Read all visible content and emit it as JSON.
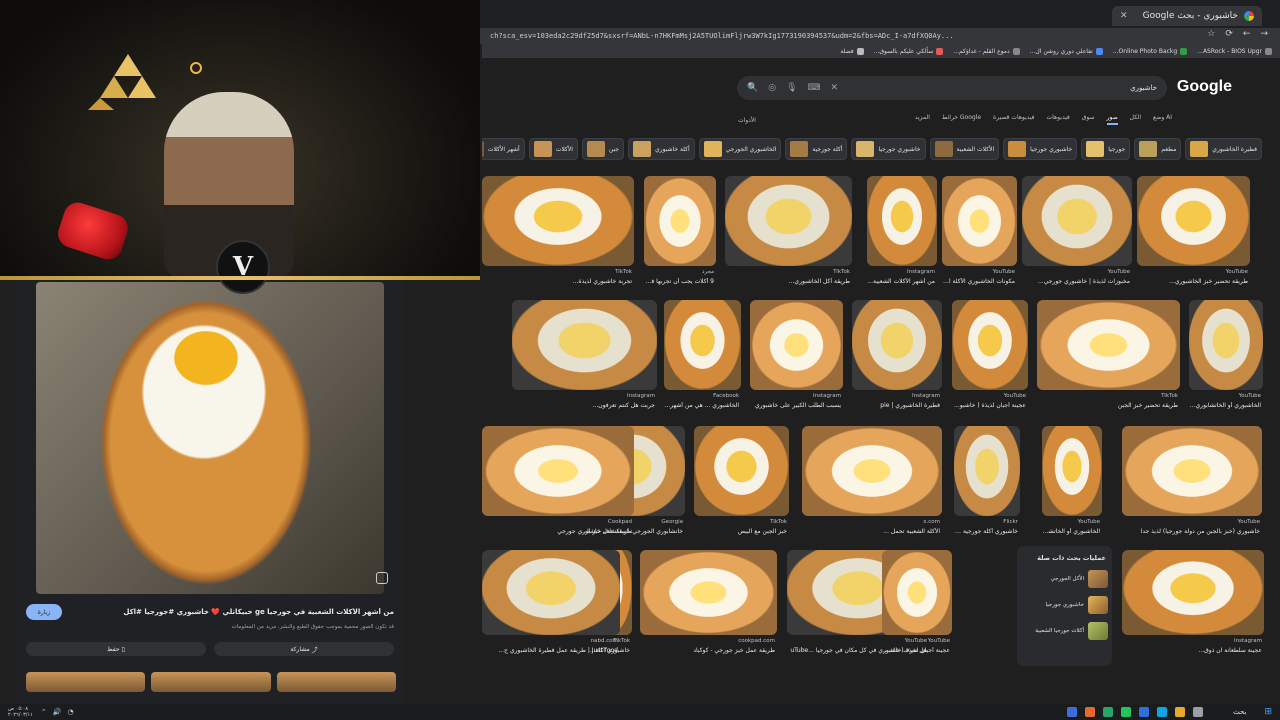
{
  "browser": {
    "tab_title": "خاشبوري - بحث Google",
    "url": "ch?sca_esv=103eda2c29df25d7&sxsrf=ANbL-n7HKFmMsj2A5TUOlimFljrw3W7kIg1773190394537&udm=2&fbs=ADc_I-a7dfXQ0Ay...",
    "bookmarks": [
      "ASRock - BIOS Upgr...",
      "Online Photo Backg...",
      "تفاعلي دوري روشن ال...",
      "دموع القلم - غداؤكم...",
      "سألكي عليكم بالسوق...",
      "فضلة"
    ]
  },
  "google": {
    "logo": "Google",
    "query": "خاشبوري",
    "filters": [
      "الكل",
      "صور",
      "سوق",
      "فيديوهات",
      "فيديوهات قصيرة",
      "خرائط Google",
      "المزيد"
    ],
    "active_filter": "صور",
    "ai_mode": "وضع AI",
    "tools": "الأدوات",
    "chips": [
      "فطيرة الخاشبوري",
      "مطعم",
      "جورجيا",
      "خاشبوري جورجيا",
      "الأكلات الشعبية",
      "خاشبوري جورجيا",
      "أكلة جورجية",
      "الخاشبوري الجورجي",
      "أكلة خاشبوري",
      "جبن",
      "الأكلات",
      "أشهر الأكلات"
    ]
  },
  "results": [
    {
      "source": "YouTube",
      "title": "طريقة تحضير خبز الخاشبوري..."
    },
    {
      "source": "YouTube",
      "title": "مخبوزات لذيذة | خاشبوري جورجي..."
    },
    {
      "source": "YouTube",
      "title": "مكونات الخاشبوري الأكلة الشعبية من دولة..."
    },
    {
      "source": "Instagram",
      "title": "من أشهر الأكلات الشعبية..."
    },
    {
      "source": "TikTok",
      "title": "طريقة أكل الخاشبوري..."
    },
    {
      "source": "مجرد",
      "title": "9 أكلات يجب أن تجربها في جورجيا"
    },
    {
      "source": "TikTok",
      "title": "تجربة خاشبوري لذيذة..."
    },
    {
      "source": "YouTube",
      "title": "الخاشبوري أو الخاتشابوري وصفة من جورجيا"
    },
    {
      "source": "TikTok",
      "title": "طريقة تحضير خبز الجبن"
    },
    {
      "source": "YouTube",
      "title": "عجينة أجبان لذيذة ( خاشبوري جورجي ) - Tube"
    },
    {
      "source": "Instagram",
      "title": "فطيرة الخاشبوري | pie"
    },
    {
      "source": "Instagram",
      "title": "يسبب الطلب الكبير على خاشبوري"
    },
    {
      "source": "Facebook",
      "title": "الخاشبوري ... هي من أشهر الأ..."
    },
    {
      "source": "Instagram",
      "title": "جربت هل كنتم تعرفون..."
    },
    {
      "source": "YouTube",
      "title": "خاشبوري (خبز بالجبن من دولة جورجيا) لذيذ جدا"
    },
    {
      "source": "YouTube",
      "title": "الخاشبوري أو الخاتشابوري ..."
    },
    {
      "source": "Flickr",
      "title": "خاشبوري أكلة جورجية تقليدية | Flickr ...org"
    },
    {
      "source": "x.com",
      "title": "الأكلة الشعبية تحمل ..."
    },
    {
      "source": "TikTok",
      "title": "خبز الجبن مع البيض"
    },
    {
      "source": "Georgia",
      "title": "خاتشابوري الجورجي: استكشاف خبز الجبنة الأيقوني"
    },
    {
      "source": "Cookpad",
      "title": "طريقة عمل خاشبوري جورجي"
    },
    {
      "source": "Instagram",
      "title": "عجينة سلطعانة ان ذوق..."
    },
    {
      "source": "YouTube",
      "title": "هل تعرف خاشبوري في كل مكان في جورجيا ...uTube"
    },
    {
      "source": "cookpad.com",
      "title": "طريقة عمل خبز جورجي - كوكباد"
    },
    {
      "source": "TikTok",
      "title": "خاشبوري أكلة شعبية ج..."
    },
    {
      "source": "nabd.com",
      "title": "Just food | طريقة عمل فطيرة الخاشبوري ج..."
    },
    {
      "source": "YouTube",
      "title": "عجينة أجبان لذيذة ( خاشبوري جورجي ) - be"
    },
    {
      "source": "TikTok",
      "title": "تجربة خاشبوري في جو..."
    },
    {
      "source": "YouTube",
      "title": "شكل جورجي (خاشبوري) - uri - YouTube"
    }
  ],
  "related": {
    "title": "عمليات بحث ذات صلة",
    "items": [
      "الأكل الجورجي",
      "خاشبوري جورجيا",
      "أكلات جورجيا الشعبية"
    ]
  },
  "side_panel": {
    "title": "من أشهر الأكلات الشعبية في جورجيا ge خبيكاتلي ❤️ خاشبوري #جورجيا #اكل",
    "subtitle": "قد تكون الصور محمية بموجب حقوق الطبع والنشر. مزيد من المعلومات",
    "visit": "زيارة",
    "share": "مشاركة",
    "save": "حفظ"
  },
  "taskbar": {
    "search": "بحث",
    "clock_time": "٠٥:٠٨ ص",
    "clock_date": "٢٠٢٦/٠٣/١١"
  }
}
